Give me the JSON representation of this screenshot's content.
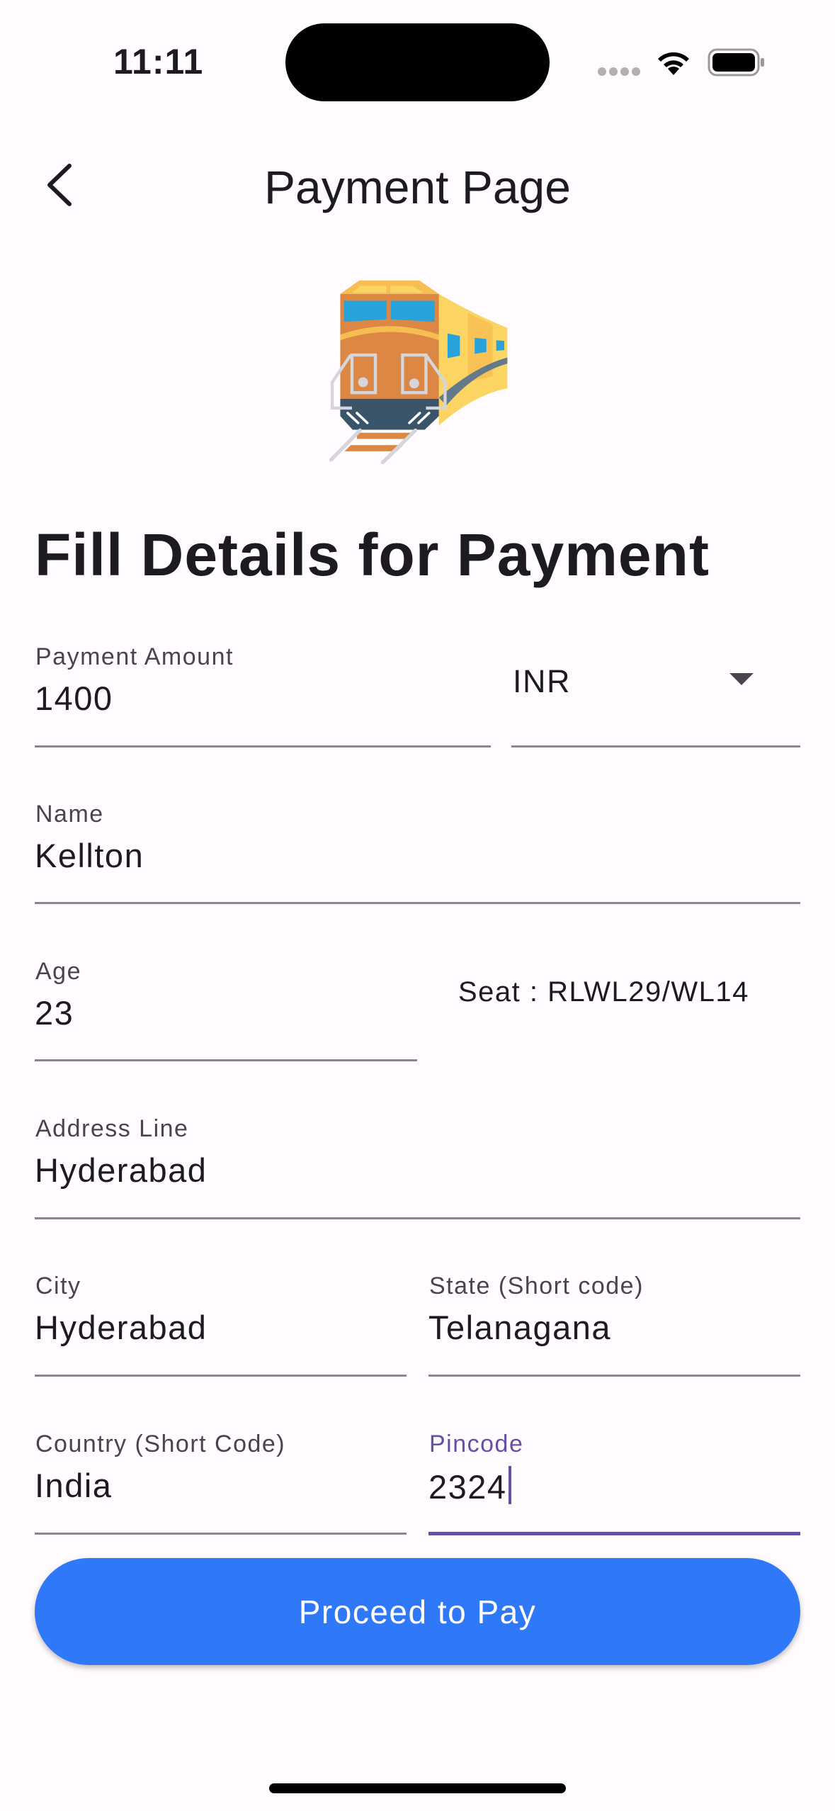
{
  "status_bar": {
    "time": "11:11",
    "icons": [
      "signal-dots-icon",
      "wifi-icon",
      "battery-icon"
    ]
  },
  "header": {
    "title": "Payment Page",
    "back_icon": "chevron-left-icon"
  },
  "hero_icon": "train-icon",
  "form": {
    "heading": "Fill Details for Payment",
    "payment_amount": {
      "label": "Payment Amount",
      "value": "1400"
    },
    "currency": {
      "value": "INR",
      "icon": "dropdown-arrow-icon"
    },
    "name": {
      "label": "Name",
      "value": "Kellton"
    },
    "age": {
      "label": "Age",
      "value": "23"
    },
    "seat": "Seat : RLWL29/WL14",
    "address": {
      "label": "Address Line",
      "value": "Hyderabad"
    },
    "city": {
      "label": "City",
      "value": "Hyderabad"
    },
    "state": {
      "label": "State (Short code)",
      "value": "Telanagana"
    },
    "country": {
      "label": "Country (Short Code)",
      "value": "India"
    },
    "pincode": {
      "label": "Pincode",
      "value": "2324",
      "focused": true
    }
  },
  "proceed_button": {
    "label": "Proceed to Pay"
  },
  "colors": {
    "accent": "#6750a4",
    "button": "#2f78f8",
    "background": "#fffbfe"
  }
}
